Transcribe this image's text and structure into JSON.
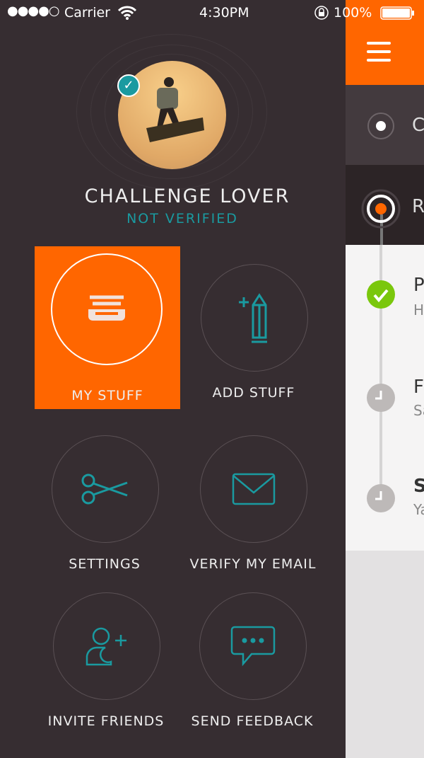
{
  "status": {
    "signal": "●●●●○",
    "carrier": "Carrier",
    "time": "4:30PM",
    "battery": "100%"
  },
  "profile": {
    "name": "CHALLENGE LOVER",
    "verification": "NOT VERIFIED"
  },
  "menu": [
    {
      "label": "MY STUFF",
      "icon": "stack-icon",
      "active": true
    },
    {
      "label": "ADD STUFF",
      "icon": "pencil-plus-icon"
    },
    {
      "label": "SETTINGS",
      "icon": "scissors-icon"
    },
    {
      "label": "VERIFY MY EMAIL",
      "icon": "envelope-icon"
    },
    {
      "label": "INVITE FRIENDS",
      "icon": "add-user-icon"
    },
    {
      "label": "SEND FEEDBACK",
      "icon": "chat-bubble-icon"
    }
  ],
  "panel": {
    "row1": "C",
    "row2": "R",
    "items": [
      {
        "title": "P",
        "sub": "H",
        "status": "done"
      },
      {
        "title": "F",
        "sub": "Sa",
        "status": "pending"
      },
      {
        "title": "S",
        "sub": "Ya",
        "status": "pending"
      }
    ]
  },
  "colors": {
    "accent": "#ff6600",
    "teal": "#1a9aa0",
    "background": "#362d31",
    "done": "#7ac70c"
  }
}
